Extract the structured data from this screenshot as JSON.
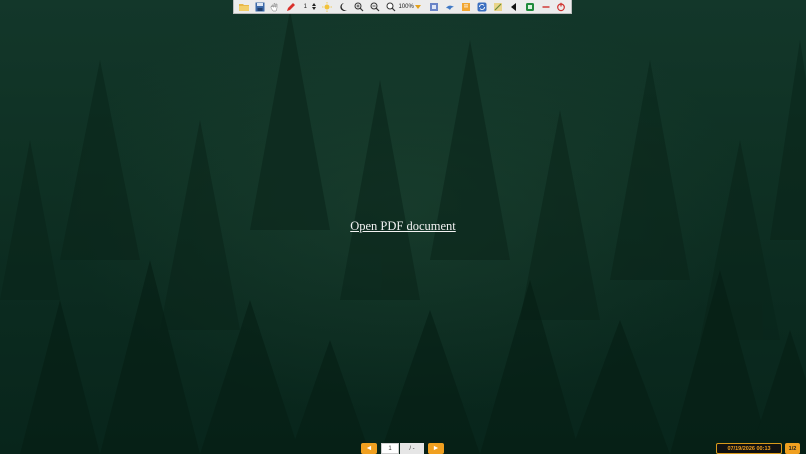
{
  "toolbar": {
    "icons": [
      "folder-open-icon",
      "save-icon",
      "hand-icon",
      "pen-icon",
      "stepper",
      "sun-icon",
      "moon-icon",
      "zoom-in-icon",
      "zoom-out-icon",
      "zoom-menu-icon",
      "fit-icon",
      "bird-icon",
      "bookmark-icon",
      "refresh-icon",
      "tools-icon",
      "prev-icon",
      "app-icon",
      "minimize-icon",
      "close-icon"
    ],
    "pen_width_value": "1",
    "zoom_value": "100%"
  },
  "main": {
    "open_link": "Open PDF document"
  },
  "footer": {
    "prev_label": "◄",
    "next_label": "►",
    "page_value": "1",
    "page_total": "/ -",
    "datetime": "07/19/2026  00:13",
    "counter": "1/2"
  },
  "colors": {
    "accent": "#f0a020",
    "background": "#0f3124"
  }
}
